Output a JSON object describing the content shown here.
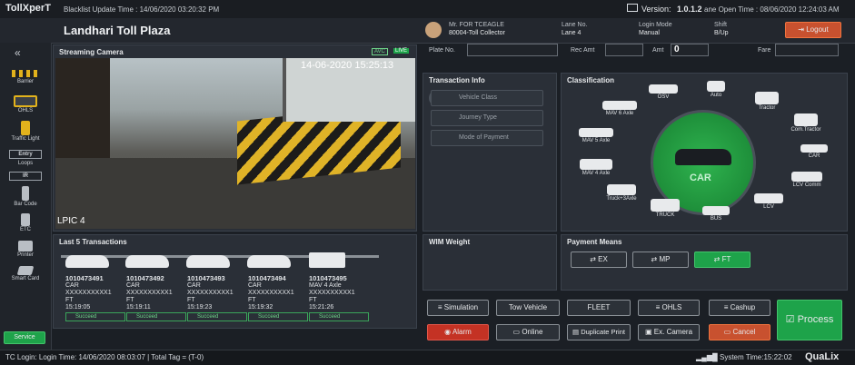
{
  "top": {
    "brand": "TollXperT",
    "blacklist": "Blacklist Update Time : 14/06/2020 03:20:32 PM",
    "version_label": "Version:",
    "version": "1.0.1.2",
    "lane_open": "ane Open Time : 08/06/2020 12:24:03 AM"
  },
  "header": {
    "plaza": "Landhari Toll Plaza",
    "user_name": "Mr. FOR TCEAGLE",
    "user_role": "80004-Toll Collector",
    "lane_no_label": "Lane No.",
    "lane_no": "Lane 4",
    "login_mode_label": "Login Mode",
    "login_mode": "Manual",
    "shift_label": "Shift",
    "shift": "B/Up",
    "logout": "Logout"
  },
  "sidebar": {
    "collapse": "«",
    "items": [
      "Barrier",
      "OHLS",
      "Traffic Light",
      "Entry",
      "Loops",
      "IR",
      "Bar Code",
      "ETC",
      "Printer",
      "Smart Card"
    ],
    "service": "Service"
  },
  "camera": {
    "title": "Streaming Camera",
    "timestamp": "14-06-2020 15:25:13",
    "badge_avc": "AVC",
    "badge_live": "LIVE",
    "lpic": "LPIC 4"
  },
  "fields": {
    "plate_no": "Plate No.",
    "rec_amt": "Rec Amt",
    "amt": "Amt",
    "amt_value": "0",
    "fare": "Fare"
  },
  "transaction_info": {
    "title": "Transaction Info",
    "vehicle_class": "Vehicle Class",
    "journey_type": "Journey Type",
    "payment_mode": "Mode of Payment"
  },
  "classification": {
    "title": "Classification",
    "center": "CAR",
    "vehicles": [
      "OSV",
      "Auto",
      "MAV 6 Axle",
      "Tractor",
      "Com.Tractor",
      "MAV 5 Axle",
      "CAR",
      "MAV 4 Axle",
      "LCV Comm",
      "Truck+3Axle",
      "LCV",
      "TRUCK",
      "BUS"
    ]
  },
  "last5": {
    "title": "Last 5 Transactions",
    "items": [
      {
        "id": "1010473491",
        "cls": "CAR",
        "mask": "XXXXXXXXXX1",
        "pay": "FT",
        "time": "15:19:05",
        "status": "Succeed"
      },
      {
        "id": "1010473492",
        "cls": "CAR",
        "mask": "XXXXXXXXXX1",
        "pay": "FT",
        "time": "15:19:11",
        "status": "Succeed"
      },
      {
        "id": "1010473493",
        "cls": "CAR",
        "mask": "XXXXXXXXXX1",
        "pay": "FT",
        "time": "15:19:23",
        "status": "Succeed"
      },
      {
        "id": "1010473494",
        "cls": "CAR",
        "mask": "XXXXXXXXXX1",
        "pay": "FT",
        "time": "15:19:32",
        "status": "Succeed"
      },
      {
        "id": "1010473495",
        "cls": "MAV 4 Axle",
        "mask": "XXXXXXXXXX1",
        "pay": "FT",
        "time": "15:21:26",
        "status": "Succeed"
      }
    ]
  },
  "wim": {
    "title": "WIM Weight"
  },
  "payment": {
    "title": "Payment Means",
    "ex": "EX",
    "mp": "MP",
    "ft": "FT"
  },
  "actions": {
    "simulation": "Simulation",
    "tow": "Tow Vehicle",
    "fleet": "FLEET",
    "ohls": "OHLS",
    "cashup": "Cashup",
    "alarm": "Alarm",
    "online": "Online",
    "dup": "Duplicate Print",
    "excam": "Ex. Camera",
    "cancel": "Cancel",
    "process": "Process"
  },
  "footer": {
    "left": "TC Login: Login Time: 14/06/2020 08:03:07 | Total Tag = (T-0)",
    "sys": "System Time:15:22:02",
    "logo": "QuaLix"
  }
}
